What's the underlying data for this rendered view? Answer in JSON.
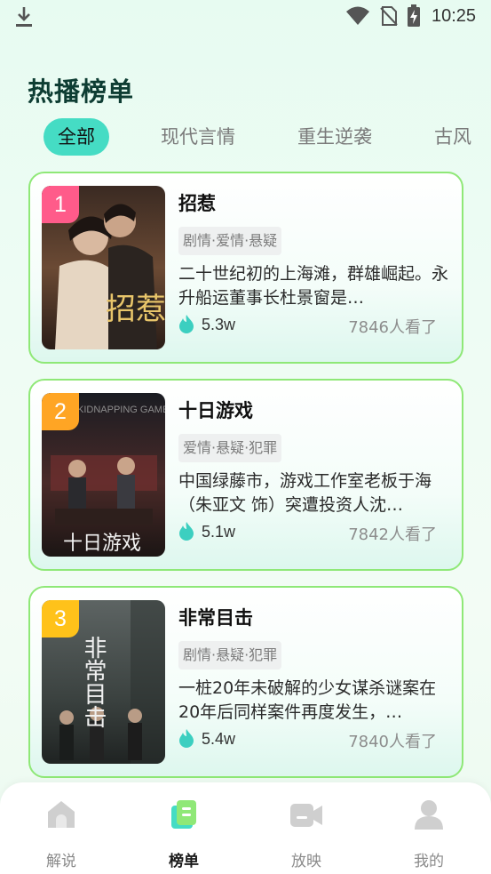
{
  "status_bar": {
    "time": "10:25"
  },
  "page": {
    "title": "热播榜单"
  },
  "tabs": [
    {
      "label": "全部",
      "active": true
    },
    {
      "label": "现代言情",
      "active": false
    },
    {
      "label": "重生逆袭",
      "active": false
    },
    {
      "label": "古风",
      "active": false
    }
  ],
  "rankings": [
    {
      "rank": "1",
      "title": "招惹",
      "tags": "剧情·爱情·悬疑",
      "description": "二十世纪初的上海滩，群雄崛起。永升船运董事长杜景窗是…",
      "heat": "5.3w",
      "views": "7846人看了",
      "poster_text": "招惹",
      "badge_color": "#ff5b8a"
    },
    {
      "rank": "2",
      "title": "十日游戏",
      "tags": "爱情·悬疑·犯罪",
      "description": "中国绿藤市，游戏工作室老板于海（朱亚文 饰）突遭投资人沈…",
      "heat": "5.1w",
      "views": "7842人看了",
      "poster_text": "十日游戏",
      "poster_top_text": "KIDNAPPING GAME",
      "badge_color": "#ffa524"
    },
    {
      "rank": "3",
      "title": "非常目击",
      "tags": "剧情·悬疑·犯罪",
      "description": "一桩20年未破解的少女谋杀谜案在20年后同样案件再度发生，…",
      "heat": "5.4w",
      "views": "7840人看了",
      "poster_text": "非常目击",
      "badge_color": "#ffc21a"
    }
  ],
  "bottom_nav": [
    {
      "label": "解说",
      "icon": "home-icon",
      "active": false
    },
    {
      "label": "榜单",
      "icon": "ranking-icon",
      "active": true
    },
    {
      "label": "放映",
      "icon": "video-camera-icon",
      "active": false
    },
    {
      "label": "我的",
      "icon": "profile-icon",
      "active": false
    }
  ],
  "colors": {
    "accent": "#45dcc4",
    "card_border": "#8fe877",
    "heat_icon": "#3ccfc0",
    "title_dark": "#0e3d33"
  }
}
